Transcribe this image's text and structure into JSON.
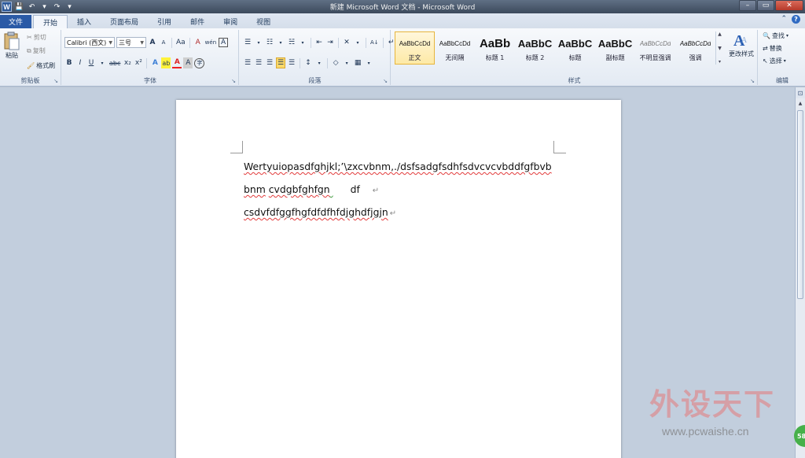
{
  "window": {
    "title": "新建 Microsoft Word 文档 - Microsoft Word",
    "app_logo": "W",
    "controls": {
      "minimize": "–",
      "maximize": "▭",
      "close": "✕"
    }
  },
  "qat": {
    "save": "💾",
    "undo": "↶",
    "undo_drop": "▾",
    "redo": "↷",
    "customize": "▾"
  },
  "tabs": [
    {
      "label": "文件"
    },
    {
      "label": "开始"
    },
    {
      "label": "插入"
    },
    {
      "label": "页面布局"
    },
    {
      "label": "引用"
    },
    {
      "label": "邮件"
    },
    {
      "label": "审阅"
    },
    {
      "label": "视图"
    }
  ],
  "help": {
    "collapse": "⌃",
    "help": "?"
  },
  "clipboard": {
    "label": "剪贴板",
    "paste": "粘贴",
    "cut": "剪切",
    "copy": "复制",
    "format_painter": "格式刷"
  },
  "font": {
    "label": "字体",
    "family": "Calibri (西文)",
    "size": "三号",
    "grow": "A",
    "shrink": "A",
    "change_case": "Aa",
    "clear": "A",
    "pinyin": "wén",
    "char_border": "A",
    "bold": "B",
    "italic": "I",
    "underline": "U",
    "strike": "abc",
    "sub": "x₂",
    "sup": "x²",
    "effects": "A",
    "highlight": "ab",
    "font_color": "A",
    "shading": "A",
    "enclose": "字"
  },
  "paragraph": {
    "label": "段落",
    "bullets": "☰",
    "numbering": "☷",
    "multilevel": "☵",
    "dec_indent": "⇤",
    "inc_indent": "⇥",
    "chinese_layout": "✕",
    "sort": "A↓",
    "show_marks": "↵",
    "align_left": "☰",
    "center": "☰",
    "align_right": "☰",
    "justify": "☰",
    "distributed": "☰",
    "line_spacing": "↕",
    "shading": "◇",
    "borders": "▦"
  },
  "styles": {
    "label": "样式",
    "items": [
      {
        "preview": "AaBbCcDd",
        "name": "正文"
      },
      {
        "preview": "AaBbCcDd",
        "name": "无间隔"
      },
      {
        "preview": "AaBb",
        "name": "标题 1"
      },
      {
        "preview": "AaBbC",
        "name": "标题 2"
      },
      {
        "preview": "AaBbC",
        "name": "标题"
      },
      {
        "preview": "AaBbC",
        "name": "副标题"
      },
      {
        "preview": "AaBbCcDd",
        "name": "不明显强调"
      },
      {
        "preview": "AaBbCcDd",
        "name": "强调"
      }
    ],
    "change_styles": "更改样式"
  },
  "editing": {
    "label": "编辑",
    "find": "查找",
    "replace": "替换",
    "select": "选择"
  },
  "document": {
    "line1": "Wertyuiopasdfghjkl;’\\zxcvbnm,./dsfsadgfsdhfsdvcvcvbddfgfbvb",
    "line2a": "bnm",
    "line2b": "cvdgbfghfgn",
    "line2c": "df",
    "line3": "csdvfdfggfhgfdfdfhfdjghdfjgjn",
    "para_mark": "↵"
  },
  "watermark": {
    "text": "外设天下",
    "url": "www.pcwaishe.cn",
    "badge": "58"
  }
}
